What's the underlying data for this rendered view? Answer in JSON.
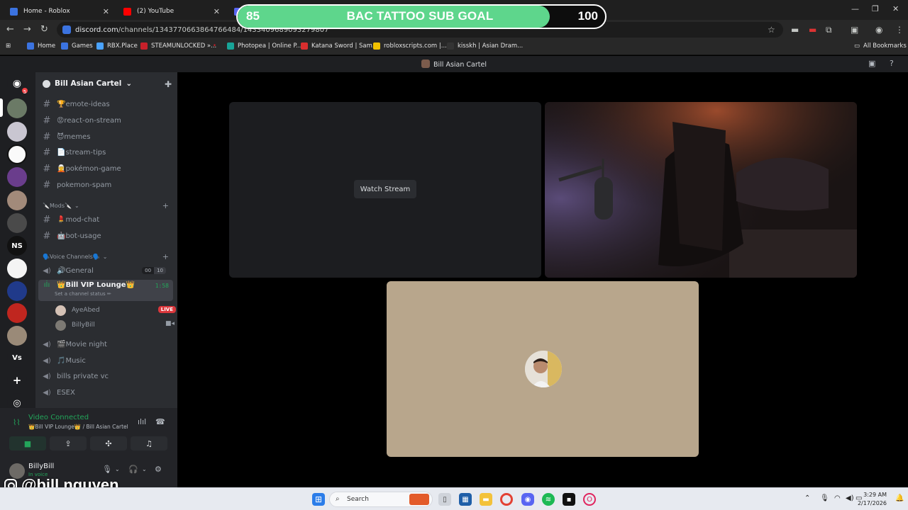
{
  "browser": {
    "tabs": [
      {
        "title": "Home - Roblox",
        "color": "#3b73e0"
      },
      {
        "title": "(2) YouTube",
        "color": "#ff0000"
      },
      {
        "title": "",
        "color": "#5865f2"
      }
    ],
    "url": {
      "host": "discord.com",
      "path": "/channels/1343770663864766484/1433409689093279807"
    },
    "bookmarks": [
      {
        "label": "Home",
        "color": "#3b73e0"
      },
      {
        "label": "Games",
        "color": "#3b73e0"
      },
      {
        "label": "RBX.Place",
        "color": "#4aa3ff"
      },
      {
        "label": "STEAMUNLOCKED »...",
        "color": "#c8202a"
      },
      {
        "label": "Photopea | Online P...",
        "color": "#18a497"
      },
      {
        "label": "Katana Sword | Sam...",
        "color": "#d92e2e"
      },
      {
        "label": "robloxscripts.com |...",
        "color": "#f2c200"
      },
      {
        "label": "kisskh | Asian Dram...",
        "color": "#333333"
      }
    ],
    "all_bookmarks": "All Bookmarks"
  },
  "goal": {
    "start": "85",
    "title": "BAC TATTOO SUB GOAL",
    "target": "100",
    "progress": 0.85,
    "fill_color": "#5ed68c"
  },
  "discord": {
    "window_title": "Bill Asian Cartel",
    "server_name": "Bill Asian Cartel",
    "home_badge": "5",
    "rail_text": {
      "ns": "NS",
      "vs": "Vs"
    },
    "text_channels": [
      {
        "name": "🏆emote-ideas"
      },
      {
        "name": "😡react-on-stream"
      },
      {
        "name": "😈memes"
      },
      {
        "name": "📄stream-tips"
      },
      {
        "name": "🧝pokémon-game"
      },
      {
        "name": "pokemon-spam"
      }
    ],
    "mods_category": "🔪Mods🔪",
    "mod_channels": [
      {
        "name": "💄mod-chat"
      },
      {
        "name": "🤖bot-usage"
      }
    ],
    "voice_category": "🗣️Voice Channels🗣️",
    "general": {
      "name": "🔊General",
      "count_a": "00",
      "count_b": "10"
    },
    "vip": {
      "name": "👑Bill VIP Lounge👑",
      "status": "Set a channel status ✏",
      "time": "1:58"
    },
    "vip_users": [
      {
        "name": "AyeAbed",
        "live": "LIVE"
      },
      {
        "name": "BillyBill"
      }
    ],
    "other_voice": [
      {
        "name": "🎬Movie night"
      },
      {
        "name": "🎵Music"
      },
      {
        "name": "bills private vc"
      },
      {
        "name": "ESEX"
      }
    ],
    "voice_panel": {
      "status": "Video Connected",
      "location": "👑Bill VIP Lounge👑 / Bill Asian Cartel"
    },
    "user": {
      "name": "BillyBill",
      "status": "In voice"
    },
    "stage": {
      "watch_label": "Watch Stream"
    }
  },
  "watermark": "@bill.nguyen",
  "taskbar": {
    "search_placeholder": "Search",
    "time": "3:29 AM",
    "date": "2/17/2026"
  }
}
